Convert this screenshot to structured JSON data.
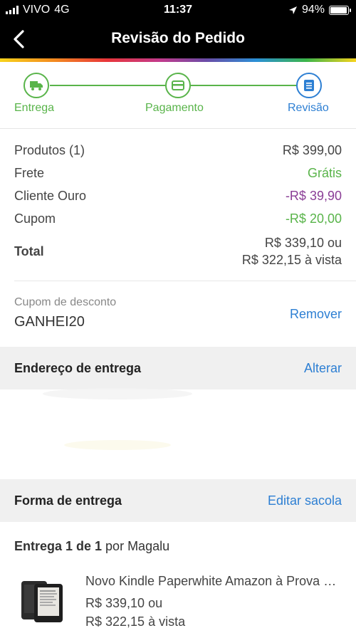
{
  "status_bar": {
    "carrier": "VIVO",
    "network": "4G",
    "time": "11:37",
    "battery": "94%"
  },
  "header": {
    "title": "Revisão do Pedido",
    "back_icon": "chevron-left-icon"
  },
  "stepper": {
    "steps": [
      {
        "label": "Entrega",
        "icon": "truck-icon",
        "state": "done"
      },
      {
        "label": "Pagamento",
        "icon": "card-icon",
        "state": "done"
      },
      {
        "label": "Revisão",
        "icon": "document-icon",
        "state": "active"
      }
    ]
  },
  "summary": {
    "products_label": "Produtos (1)",
    "products_value": "R$ 399,00",
    "shipping_label": "Frete",
    "shipping_value": "Grátis",
    "gold_label": "Cliente Ouro",
    "gold_value": "-R$ 39,90",
    "coupon_label": "Cupom",
    "coupon_value": "-R$ 20,00",
    "total_label": "Total",
    "total_value_line1": "R$ 339,10 ou",
    "total_value_line2": "R$ 322,15 à vista"
  },
  "coupon": {
    "label": "Cupom de desconto",
    "code": "GANHEI20",
    "remove_label": "Remover"
  },
  "address": {
    "title": "Endereço de entrega",
    "action": "Alterar"
  },
  "delivery": {
    "title": "Forma de entrega",
    "action": "Editar sacola",
    "shipment_prefix": "Entrega 1 de 1",
    "shipment_suffix": " por Magalu"
  },
  "product": {
    "name": "Novo Kindle Paperwhite Amazon à Prova D'Água",
    "price_line1": "R$ 339,10 ou",
    "price_line2": "R$ 322,15 à vista"
  },
  "colors": {
    "green": "#59b44a",
    "blue": "#2d7fd3",
    "purple": "#8a3e96"
  }
}
